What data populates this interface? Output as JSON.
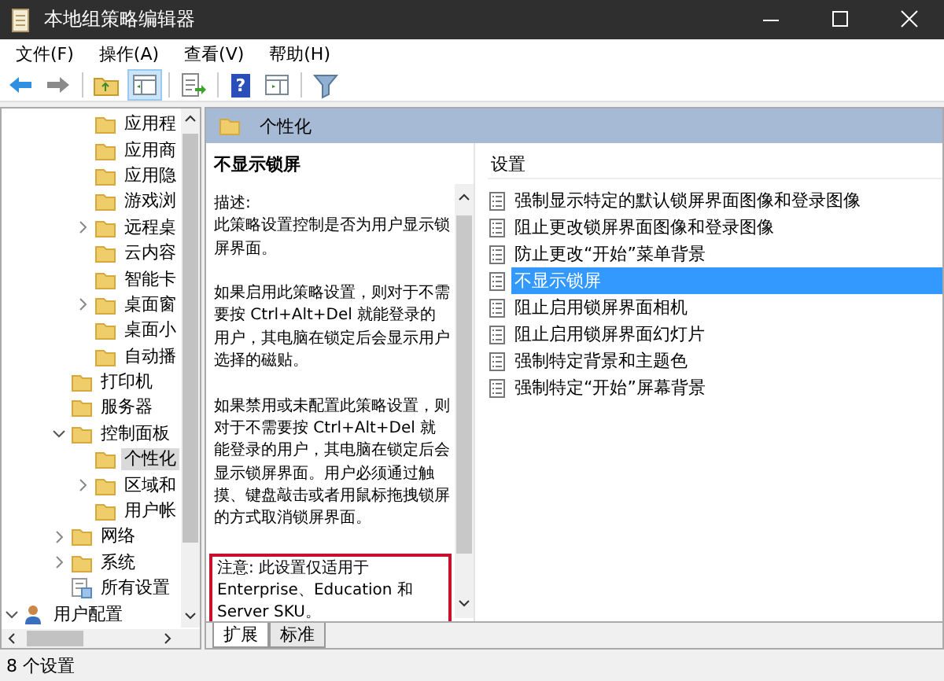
{
  "window": {
    "title": "本地组策略编辑器"
  },
  "menu": [
    "文件(F)",
    "操作(A)",
    "查看(V)",
    "帮助(H)"
  ],
  "toolbar": {
    "console_tree_shown": true,
    "help_glyph": "?"
  },
  "tree": {
    "items": [
      {
        "children": [
          {
            "children": [
              {
                "children": [
                  {
                    "label": "应用程",
                    "kind": "folder",
                    "selected": false
                  },
                  {
                    "label": "应用商",
                    "kind": "folder",
                    "selected": false
                  },
                  {
                    "label": "应用隐",
                    "kind": "folder",
                    "selected": false
                  },
                  {
                    "label": "游戏浏",
                    "kind": "folder",
                    "selected": false
                  },
                  {
                    "label": "远程桌",
                    "kind": "folder",
                    "selected": false,
                    "expanded": false
                  },
                  {
                    "label": "云内容",
                    "kind": "folder",
                    "selected": false
                  },
                  {
                    "label": "智能卡",
                    "kind": "folder",
                    "selected": false
                  },
                  {
                    "label": "桌面窗",
                    "kind": "folder",
                    "selected": false,
                    "expanded": false
                  },
                  {
                    "label": "桌面小",
                    "kind": "folder",
                    "selected": false
                  },
                  {
                    "label": "自动播",
                    "kind": "folder",
                    "selected": false
                  }
                ]
              },
              {
                "label": "打印机",
                "kind": "folder",
                "selected": false
              },
              {
                "label": "服务器",
                "kind": "folder",
                "selected": false
              },
              {
                "label": "控制面板",
                "kind": "folder",
                "selected": false,
                "expanded": true,
                "children": [
                  {
                    "label": "个性化",
                    "kind": "folder",
                    "selected": true
                  },
                  {
                    "label": "区域和",
                    "kind": "folder",
                    "selected": false,
                    "expanded": false
                  },
                  {
                    "label": "用户帐",
                    "kind": "folder",
                    "selected": false
                  }
                ]
              },
              {
                "label": "网络",
                "kind": "folder",
                "selected": false,
                "expanded": false
              },
              {
                "label": "系统",
                "kind": "folder",
                "selected": false,
                "expanded": false
              },
              {
                "label": "所有设置",
                "kind": "settings",
                "selected": false
              }
            ]
          }
        ]
      },
      {
        "label": "用户配置",
        "kind": "user",
        "selected": false,
        "expanded": true
      }
    ]
  },
  "header": {
    "title": "个性化"
  },
  "description": {
    "title": "不显示锁屏",
    "heading": "描述:",
    "paragraphs": [
      "此策略设置控制是否为用户显示锁屏界面。",
      "如果启用此策略设置，则对于不需要按 Ctrl+Alt+Del 就能登录的用户，其电脑在锁定后会显示用户选择的磁贴。",
      "如果禁用或未配置此策略设置，则对于不需要按 Ctrl+Alt+Del 就能登录的用户，其电脑在锁定后会显示锁屏界面。用户必须通过触摸、键盘敲击或者用鼠标拖拽锁屏的方式取消锁屏界面。"
    ],
    "note": "注意: 此设置仅适用于 Enterprise、Education 和 Server SKU。",
    "note_highlighted": true
  },
  "settings_list": {
    "column": "设置",
    "items": [
      {
        "label": "强制显示特定的默认锁屏界面图像和登录图像",
        "selected": false
      },
      {
        "label": "阻止更改锁屏界面图像和登录图像",
        "selected": false
      },
      {
        "label": "防止更改“开始”菜单背景",
        "selected": false
      },
      {
        "label": "不显示锁屏",
        "selected": true
      },
      {
        "label": "阻止启用锁屏界面相机",
        "selected": false
      },
      {
        "label": "阻止启用锁屏界面幻灯片",
        "selected": false
      },
      {
        "label": "强制特定背景和主题色",
        "selected": false
      },
      {
        "label": "强制特定“开始”屏幕背景",
        "selected": false
      }
    ]
  },
  "tabs": [
    {
      "label": "扩展",
      "selected": true
    },
    {
      "label": "标准",
      "selected": false
    }
  ],
  "status_bar": "8 个设置"
}
